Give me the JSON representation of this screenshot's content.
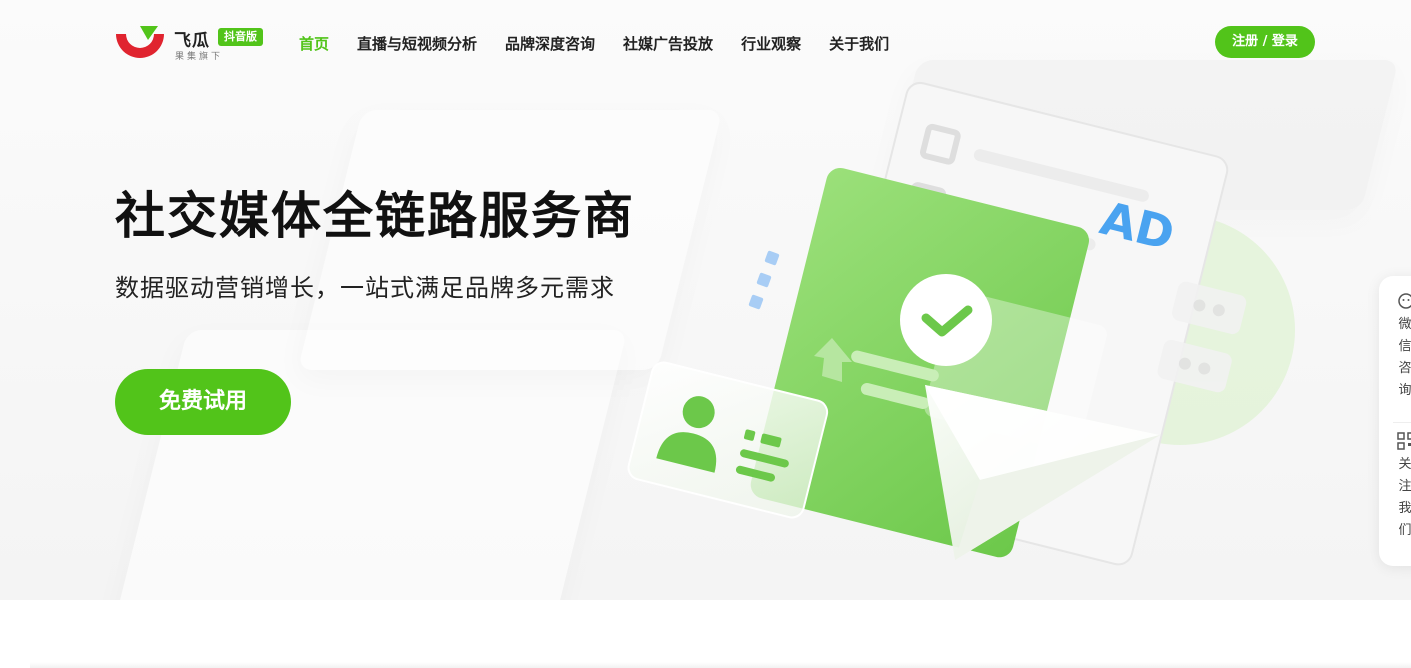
{
  "brand": {
    "name": "飞瓜",
    "badge": "抖音版",
    "subtitle": "果集旗下"
  },
  "nav": {
    "items": [
      {
        "label": "首页",
        "active": true
      },
      {
        "label": "直播与短视频分析",
        "active": false
      },
      {
        "label": "品牌深度咨询",
        "active": false
      },
      {
        "label": "社媒广告投放",
        "active": false
      },
      {
        "label": "行业观察",
        "active": false
      },
      {
        "label": "关于我们",
        "active": false
      }
    ],
    "login_label": "注册 / 登录"
  },
  "hero": {
    "title": "社交媒体全链路服务商",
    "subtitle": "数据驱动营销增长，一站式满足品牌多元需求",
    "cta_label": "免费试用",
    "illustration_text": "AD"
  },
  "side_panel": {
    "wechat_label": "微信咨询",
    "follow_label": "关注我们"
  },
  "colors": {
    "accent": "#52c41a",
    "logo_red": "#e0242f",
    "ad_blue": "#4aa3f0"
  },
  "icons": [
    "wechat-consult-icon",
    "qr-code-icon",
    "check-icon",
    "user-icon",
    "paper-plane-icon",
    "upload-arrow-icon"
  ]
}
